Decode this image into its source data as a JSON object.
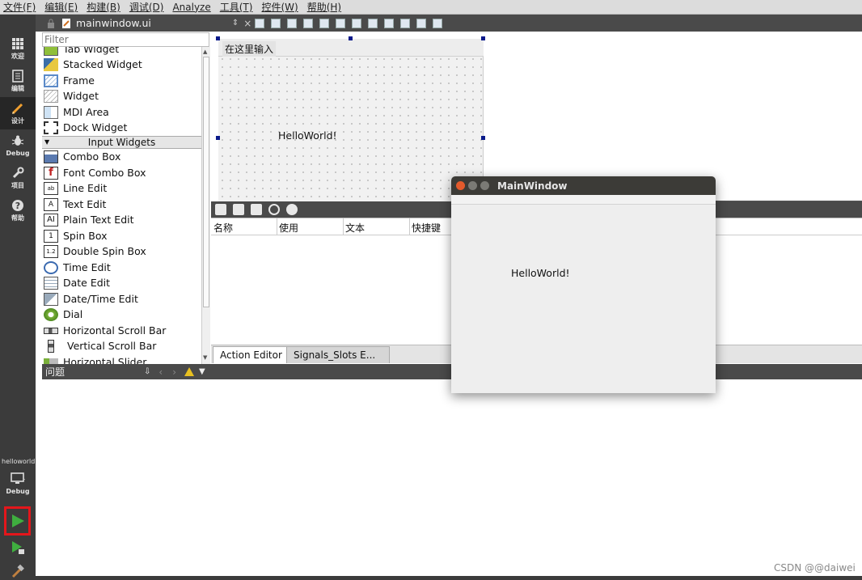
{
  "menu": [
    "文件(F)",
    "编辑(E)",
    "构建(B)",
    "调试(D)",
    "Analyze",
    "工具(T)",
    "控件(W)",
    "帮助(H)"
  ],
  "modes": [
    {
      "label": "欢迎"
    },
    {
      "label": "编辑"
    },
    {
      "label": "设计"
    },
    {
      "label": "Debug"
    },
    {
      "label": "项目"
    },
    {
      "label": "帮助"
    }
  ],
  "project": {
    "name": "helloworld",
    "kit": "Debug"
  },
  "editor": {
    "file": "mainwindow.ui"
  },
  "widget_box": {
    "filter_placeholder": "Filter",
    "items_top": [
      "Tab Widget",
      "Stacked Widget",
      "Frame",
      "Widget",
      "MDI Area",
      "Dock Widget"
    ],
    "category": "Input Widgets",
    "items": [
      "Combo Box",
      "Font Combo Box",
      "Line Edit",
      "Text Edit",
      "Plain Text Edit",
      "Spin Box",
      "Double Spin Box",
      "Time Edit",
      "Date Edit",
      "Date/Time Edit",
      "Dial",
      "Horizontal Scroll Bar",
      "Vertical Scroll Bar",
      "Horizontal Slider"
    ]
  },
  "form": {
    "menu_placeholder": "在这里输入",
    "label": "HelloWorld!"
  },
  "action_editor": {
    "columns": [
      "名称",
      "使用",
      "文本",
      "快捷键"
    ],
    "tabs": [
      "Action Editor",
      "Signals_Slots E..."
    ]
  },
  "issues": {
    "title": "问题"
  },
  "main_window": {
    "title": "MainWindow",
    "label": "HelloWorld!"
  },
  "watermark": "CSDN @@daiwei",
  "colors": {
    "run_highlight": "#e4161b",
    "run_green": "#3fae3f",
    "title_bar": "#3c3b37"
  }
}
